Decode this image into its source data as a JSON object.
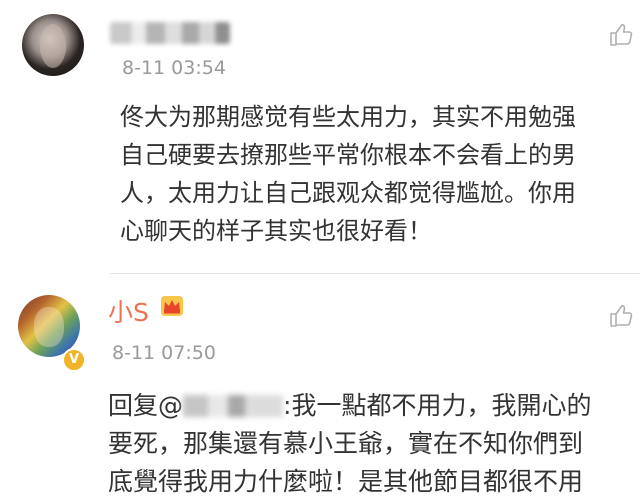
{
  "comments": [
    {
      "time": "8-11 03:54",
      "lines": [
        "佟大为那期感觉有些太用力，其实不用勉强",
        "自己硬要去撩那些平常你根本不会看上的男",
        "人，太用力让自己跟观众都觉得尴尬。你用",
        "心聊天的样子其实也很好看！"
      ]
    },
    {
      "name": "小S",
      "time": "8-11 07:50",
      "reply_prefix": "回复@",
      "reply_rest": ":我一點都不用力，我開心的",
      "lines": [
        "要死，那集還有慕小王爺，實在不知你們到",
        "底覺得我用力什麼啦！是其他節目都很不用"
      ]
    }
  ],
  "icons": {
    "like": "thumbs-up-icon",
    "crown": "crown-icon",
    "verified": "verified-v-icon"
  },
  "colors": {
    "name": "#eb7350",
    "time": "#9a9a9a",
    "text": "#333333"
  }
}
